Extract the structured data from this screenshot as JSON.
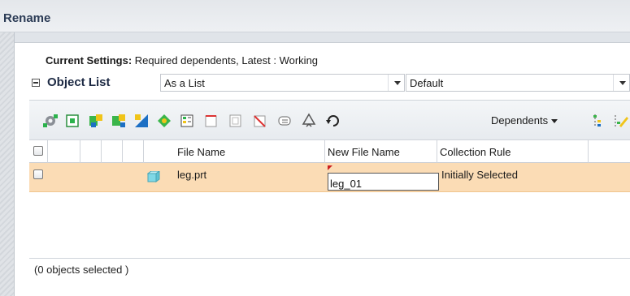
{
  "window": {
    "title": "Rename"
  },
  "settings": {
    "label": "Current Settings:",
    "value": "Required dependents, Latest : Working"
  },
  "object_list": {
    "label": "Object List",
    "view_select": {
      "value": "As a List"
    },
    "filter_select": {
      "value": "Default"
    }
  },
  "toolbar": {
    "icons": [
      "gear-icon",
      "window-icon",
      "add-icon",
      "add-tree-icon",
      "pattern-icon",
      "diamond-icon",
      "list-icon",
      "frame-icon",
      "bracket-icon",
      "no-icon",
      "tag-icon",
      "recycle-icon",
      "refresh-icon",
      "structure-icon",
      "edit-icon"
    ],
    "dependents_label": "Dependents"
  },
  "table": {
    "columns": [
      "File Name",
      "New File Name",
      "Collection Rule"
    ],
    "rows": [
      {
        "file_name": "leg.prt",
        "new_file_name": "leg_01",
        "collection_rule": "Initially Selected"
      }
    ]
  },
  "status": {
    "text": "(0 objects selected )"
  },
  "colors": {
    "selected_row": "#fbdcb5",
    "accent": "#cc1f1f"
  }
}
